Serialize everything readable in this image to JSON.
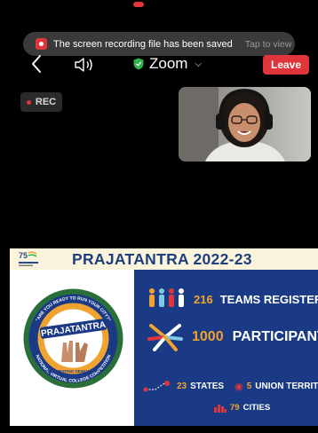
{
  "toast": {
    "message": "The screen recording file has been saved",
    "action": "Tap to view"
  },
  "topbar": {
    "back_icon": "chevron-left-icon",
    "speaker_icon": "speaker-icon",
    "app_name": "Zoom",
    "leave_label": "Leave"
  },
  "recording": {
    "label": "REC"
  },
  "slide": {
    "title": "PRAJATANTRA 2022-23",
    "emblem": {
      "arc_top": "\"ARE YOU READY TO RUN YOUR CITY?\"",
      "wordmark": "PRAJATANTRA",
      "tagline": "CELEBRATING DEMOCRACY",
      "arc_bottom": "NATIONAL VIRTUAL COLLEGE COMPETITION"
    },
    "stats": {
      "teams_count": "216",
      "teams_label": "TEAMS REGISTERED",
      "participants_count": "1000",
      "participants_label": "PARTICIPANTS",
      "states_count": "23",
      "states_label": "STATES",
      "ut_count": "5",
      "ut_label": "UNION TERRITORIES",
      "cities_count": "79",
      "cities_label": "CITIES"
    }
  },
  "colors": {
    "accent_red": "#e0353a",
    "slide_blue": "#1b3a86",
    "stat_orange": "#f0a330",
    "title_blue": "#1f3e7e"
  }
}
